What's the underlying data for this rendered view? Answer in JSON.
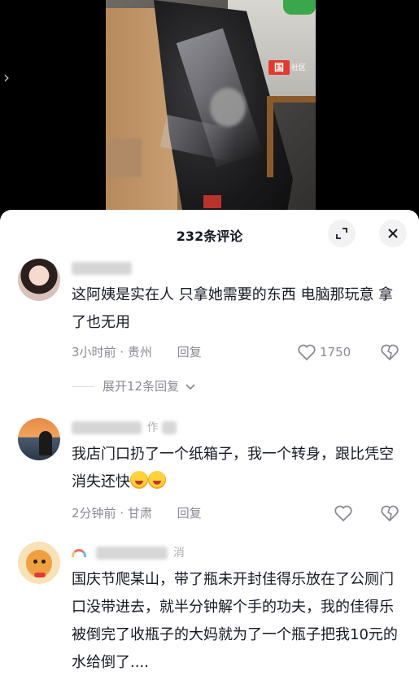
{
  "video": {
    "watermark": "国",
    "watermark_sub": "社区"
  },
  "panel": {
    "title": "232条评论"
  },
  "comments": [
    {
      "username_tail": "",
      "text": "这阿姨是实在人 只拿她需要的东西 电脑那玩意 拿了也无用",
      "time": "3小时前",
      "location": "贵州",
      "reply_label": "回复",
      "like_count": "1750",
      "expand_label": "展开12条回复"
    },
    {
      "username_tail": "作",
      "text": "我店门口扔了一个纸箱子，我一个转身，跟比凭空消失还快",
      "time": "2分钟前",
      "location": "甘肃",
      "reply_label": "回复",
      "like_count": ""
    },
    {
      "username_tail": "消",
      "text": "国庆节爬某山，带了瓶未开封佳得乐放在了公厕门口没带进去，就半分钟解个手的功夫，我的佳得乐被倒完了收瓶子的大妈就为了一个瓶子把我10元的水给倒了...."
    }
  ],
  "icons": {
    "left_arrow": "chevron-left-icon",
    "expand": "expand-icon",
    "close": "close-icon",
    "heart": "heart-outline-icon",
    "dislike": "broken-heart-icon",
    "chevron": "chevron-down-icon"
  }
}
